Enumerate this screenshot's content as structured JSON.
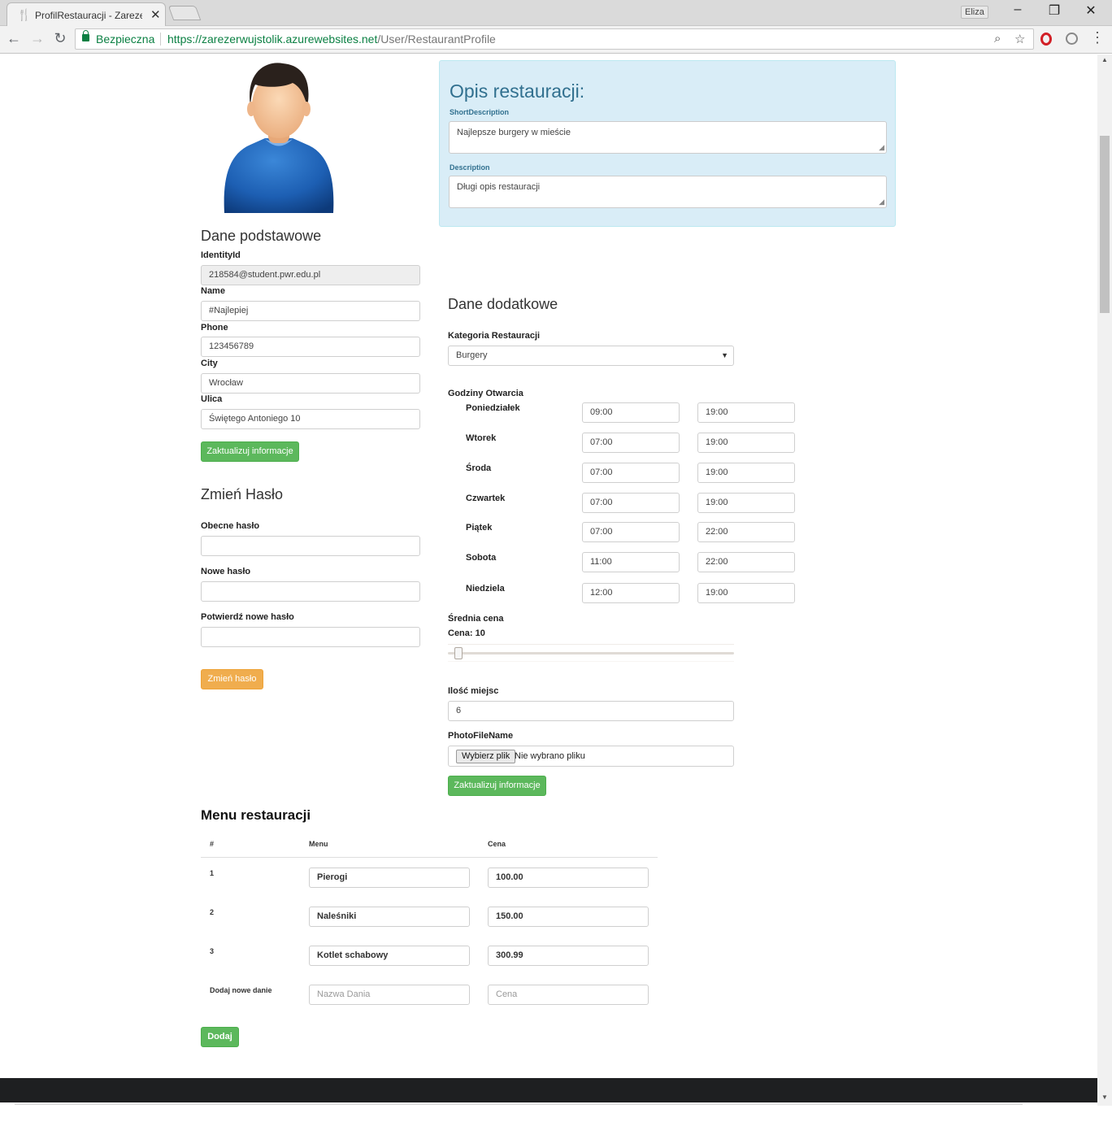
{
  "browser": {
    "tab_title": "ProfilRestauracji - Zarezerwuj",
    "tab_close": "✕",
    "profile_name": "Eliza",
    "secure_label": "Bezpieczna",
    "url_host": "https://zarezerwujstolik.azurewebsites.net",
    "url_path": "/User/RestaurantProfile",
    "win_minimize": "–",
    "win_restore": "❐",
    "win_close": "✕",
    "back": "←",
    "forward": "→",
    "reload": "↻",
    "zoom_icon": "⌕",
    "star_icon": "☆",
    "menu_icon": "⋮",
    "tab_favicon": "🍴"
  },
  "basic": {
    "heading": "Dane podstawowe",
    "identity_label": "IdentityId",
    "identity_value": "218584@student.pwr.edu.pl",
    "name_label": "Name",
    "name_value": "#Najlepiej",
    "phone_label": "Phone",
    "phone_value": "123456789",
    "city_label": "City",
    "city_value": "Wrocław",
    "street_label": "Ulica",
    "street_value": "Świętego Antoniego 10",
    "update_button": "Zaktualizuj informacje"
  },
  "password": {
    "heading": "Zmień Hasło",
    "current_label": "Obecne hasło",
    "new_label": "Nowe hasło",
    "confirm_label": "Potwierdź nowe hasło",
    "change_button": "Zmień hasło"
  },
  "description": {
    "title": "Opis restauracji:",
    "short_label": "ShortDescription",
    "short_value": "Najlepsze burgery w mieście",
    "long_label": "Description",
    "long_value": "Długi opis restauracji"
  },
  "extra": {
    "heading": "Dane dodatkowe",
    "category_label": "Kategoria Restauracji",
    "category_value": "Burgery",
    "hours_label": "Godziny Otwarcia",
    "hours": [
      {
        "day": "Poniedziałek",
        "open": "09:00",
        "close": "19:00"
      },
      {
        "day": "Wtorek",
        "open": "07:00",
        "close": "19:00"
      },
      {
        "day": "Środa",
        "open": "07:00",
        "close": "19:00"
      },
      {
        "day": "Czwartek",
        "open": "07:00",
        "close": "19:00"
      },
      {
        "day": "Piątek",
        "open": "07:00",
        "close": "22:00"
      },
      {
        "day": "Sobota",
        "open": "11:00",
        "close": "22:00"
      },
      {
        "day": "Niedziela",
        "open": "12:00",
        "close": "19:00"
      }
    ],
    "price_label": "Średnia cena",
    "price_value_text": "Cena: 10",
    "seats_label": "Ilość miejsc",
    "seats_value": "6",
    "photo_label": "PhotoFileName",
    "file_button": "Wybierz plik",
    "file_status": "Nie wybrano pliku",
    "update_button": "Zaktualizuj informacje"
  },
  "menu": {
    "title": "Menu restauracji",
    "col_num": "#",
    "col_menu": "Menu",
    "col_price": "Cena",
    "rows": [
      {
        "num": "1",
        "name": "Pierogi",
        "price": "100.00"
      },
      {
        "num": "2",
        "name": "Naleśniki",
        "price": "150.00"
      },
      {
        "num": "3",
        "name": "Kotlet schabowy",
        "price": "300.99"
      }
    ],
    "new_row_label": "Dodaj nowe danie",
    "new_name_placeholder": "Nazwa Dania",
    "new_price_placeholder": "Cena",
    "add_button": "Dodaj"
  }
}
